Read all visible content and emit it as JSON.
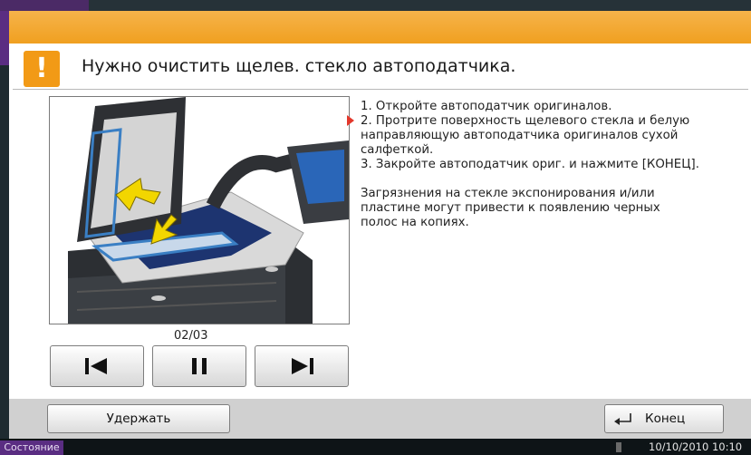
{
  "header": {
    "title": "Нужно очистить щелев. стекло автоподатчика.",
    "icon": "warning-exclamation-icon",
    "accent_color": "#f29a16"
  },
  "instructions": {
    "steps": [
      "1. Откройте автоподатчик оригиналов.",
      "2. Протрите поверхность щелевого стекла и белую направляющую автоподатчика оригиналов сухой салфеткой.",
      "3. Закройте автоподатчик ориг. и нажмите [КОНЕЦ]."
    ],
    "note": "Загрязнения на стекле экспонирования и/или пластине могут привести к  появлению черных полос на копиях."
  },
  "animation": {
    "page_indicator": "02/03",
    "controls": [
      "skip-back-icon",
      "pause-icon",
      "skip-forward-icon"
    ]
  },
  "footer": {
    "hold_label": "Удержать",
    "end_label": "Конец",
    "end_icon": "return-arrow-icon"
  },
  "statusbar": {
    "status_label": "Состояние",
    "datetime": "10/10/2010  10:10"
  }
}
